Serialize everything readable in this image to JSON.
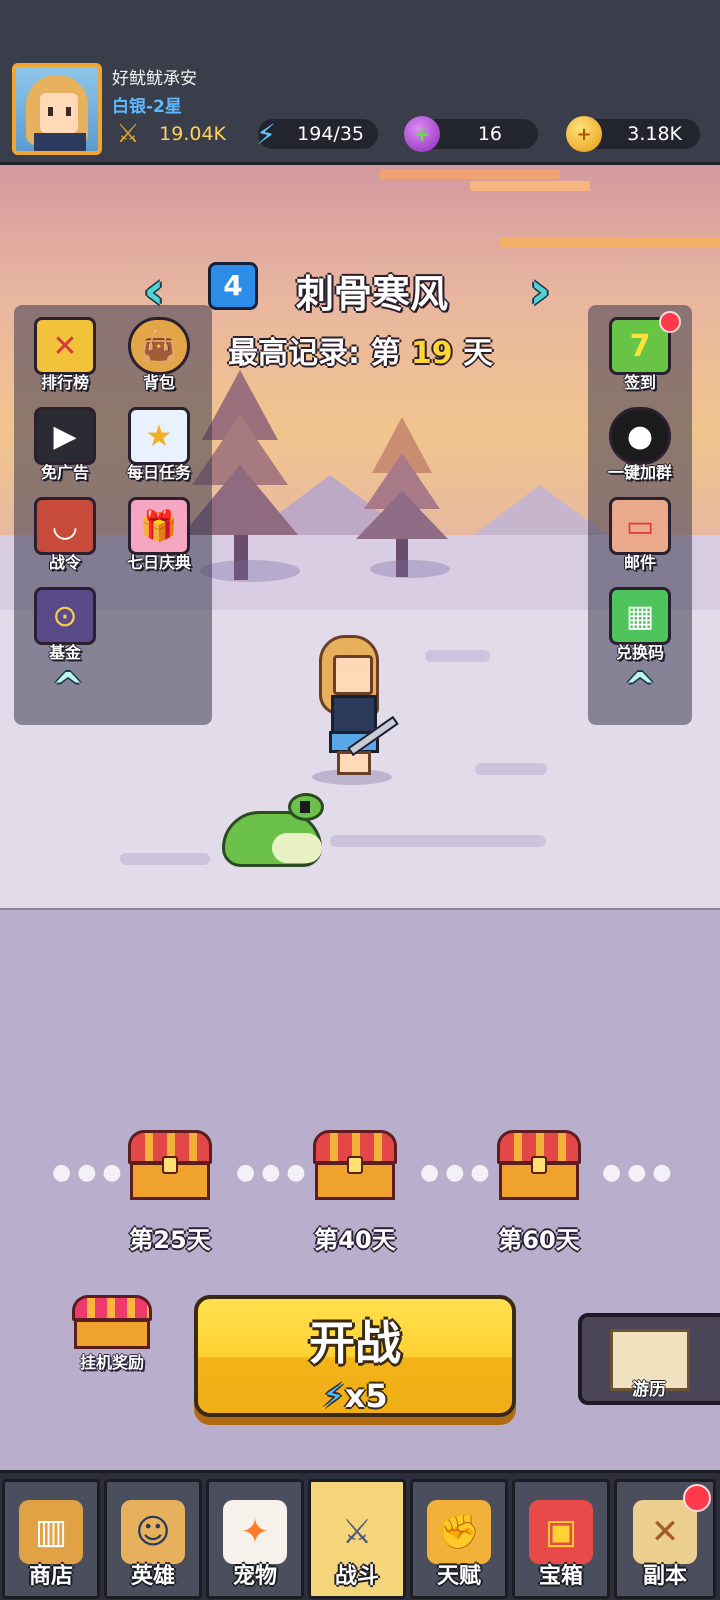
{
  "player": {
    "name": "好鱿鱿承安",
    "rank": "白银-2星",
    "power": "19.04K",
    "energy": "194/35",
    "gems": "16",
    "gold": "3.18K"
  },
  "level": {
    "number": "4",
    "name": "刺骨寒风",
    "record_prefix": "最高记录: 第",
    "record_days": "19",
    "record_suffix": "天"
  },
  "left_menu": [
    {
      "label": "排行榜",
      "icon": "leaderboard-icon"
    },
    {
      "label": "背包",
      "icon": "backpack-icon"
    },
    {
      "label": "免广告",
      "icon": "no-ads-icon"
    },
    {
      "label": "每日任务",
      "icon": "daily-task-icon"
    },
    {
      "label": "战令",
      "icon": "battle-pass-icon"
    },
    {
      "label": "七日庆典",
      "icon": "gift-icon"
    },
    {
      "label": "基金",
      "icon": "fund-safe-icon"
    }
  ],
  "right_menu": [
    {
      "label": "签到",
      "icon": "calendar-icon",
      "badge_value": "7"
    },
    {
      "label": "一键加群",
      "icon": "penguin-icon"
    },
    {
      "label": "邮件",
      "icon": "mail-scroll-icon"
    },
    {
      "label": "兑换码",
      "icon": "redeem-code-icon"
    }
  ],
  "milestones": [
    {
      "label": "第25天"
    },
    {
      "label": "第40天"
    },
    {
      "label": "第60天"
    }
  ],
  "actions": {
    "idle_reward": "挂机奖励",
    "fight_title": "开战",
    "fight_cost": "x5",
    "travel": "游历"
  },
  "nav": [
    {
      "label": "商店",
      "icon": "shop-icon"
    },
    {
      "label": "英雄",
      "icon": "hero-icon"
    },
    {
      "label": "宠物",
      "icon": "pet-icon"
    },
    {
      "label": "战斗",
      "icon": "swords-icon",
      "active": true
    },
    {
      "label": "天赋",
      "icon": "talent-icon"
    },
    {
      "label": "宝箱",
      "icon": "chest-icon"
    },
    {
      "label": "副本",
      "icon": "dungeon-map-icon"
    }
  ],
  "colors": {
    "accent_yellow": "#ffd233",
    "energy_blue": "#5ac8ff",
    "rank_blue": "#5cb8ff",
    "record_highlight": "#ffd633",
    "notification_red": "#ff3a4a"
  }
}
